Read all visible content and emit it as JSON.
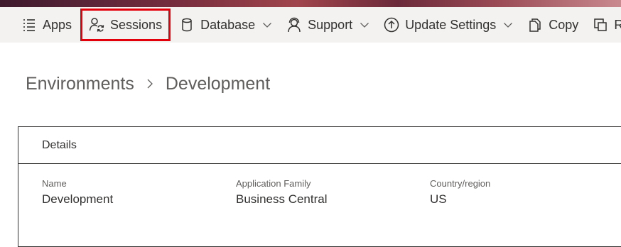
{
  "toolbar": {
    "items": [
      {
        "label": "Apps",
        "icon": "apps-list-icon"
      },
      {
        "label": "Sessions",
        "icon": "sessions-icon",
        "selected": true
      },
      {
        "label": "Database",
        "icon": "database-icon",
        "dropdown": true
      },
      {
        "label": "Support",
        "icon": "support-icon",
        "dropdown": true
      },
      {
        "label": "Update Settings",
        "icon": "update-arrow-icon",
        "dropdown": true
      },
      {
        "label": "Copy",
        "icon": "copy-icon"
      },
      {
        "label": "Re",
        "icon": "rename-icon"
      }
    ]
  },
  "breadcrumb": {
    "parent": "Environments",
    "current": "Development"
  },
  "details": {
    "header": "Details",
    "fields": [
      {
        "label": "Name",
        "value": "Development"
      },
      {
        "label": "Application Family",
        "value": "Business Central"
      },
      {
        "label": "Country/region",
        "value": "US"
      }
    ]
  },
  "colors": {
    "highlight": "#e3000b",
    "toolbar_bg": "#f3f2f1",
    "text": "#323130",
    "muted": "#605e5c"
  }
}
